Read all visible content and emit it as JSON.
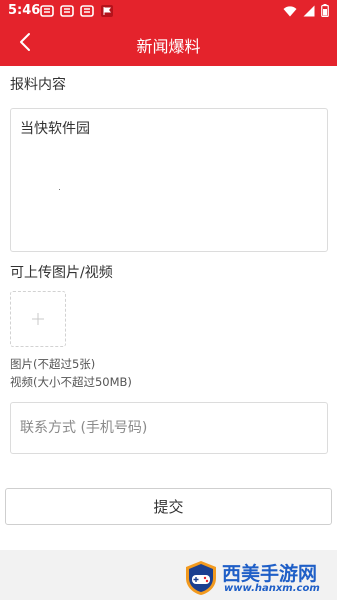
{
  "status_bar": {
    "time": "5:46",
    "notification_icons": [
      "app-notification-icon",
      "app-notification-icon",
      "app-notification-icon",
      "flag-notification-icon"
    ]
  },
  "nav": {
    "title": "新闻爆料",
    "back_icon": "chevron-left-icon"
  },
  "form": {
    "content_label": "报料内容",
    "content_value": "当快软件园",
    "upload_label": "可上传图片/视频",
    "upload_icon": "plus-icon",
    "image_hint": "图片(不超过5张)",
    "video_hint": "视频(大小不超过50MB)",
    "contact_placeholder": "联系方式 (手机号码)",
    "contact_value": "",
    "submit_label": "提交"
  },
  "watermark": {
    "title": "西美手游网",
    "url": "www.hanxm.com"
  },
  "colors": {
    "header_red": "#e4232c",
    "watermark_blue": "#1f5fc7",
    "page_bg": "#f2f2f2"
  }
}
